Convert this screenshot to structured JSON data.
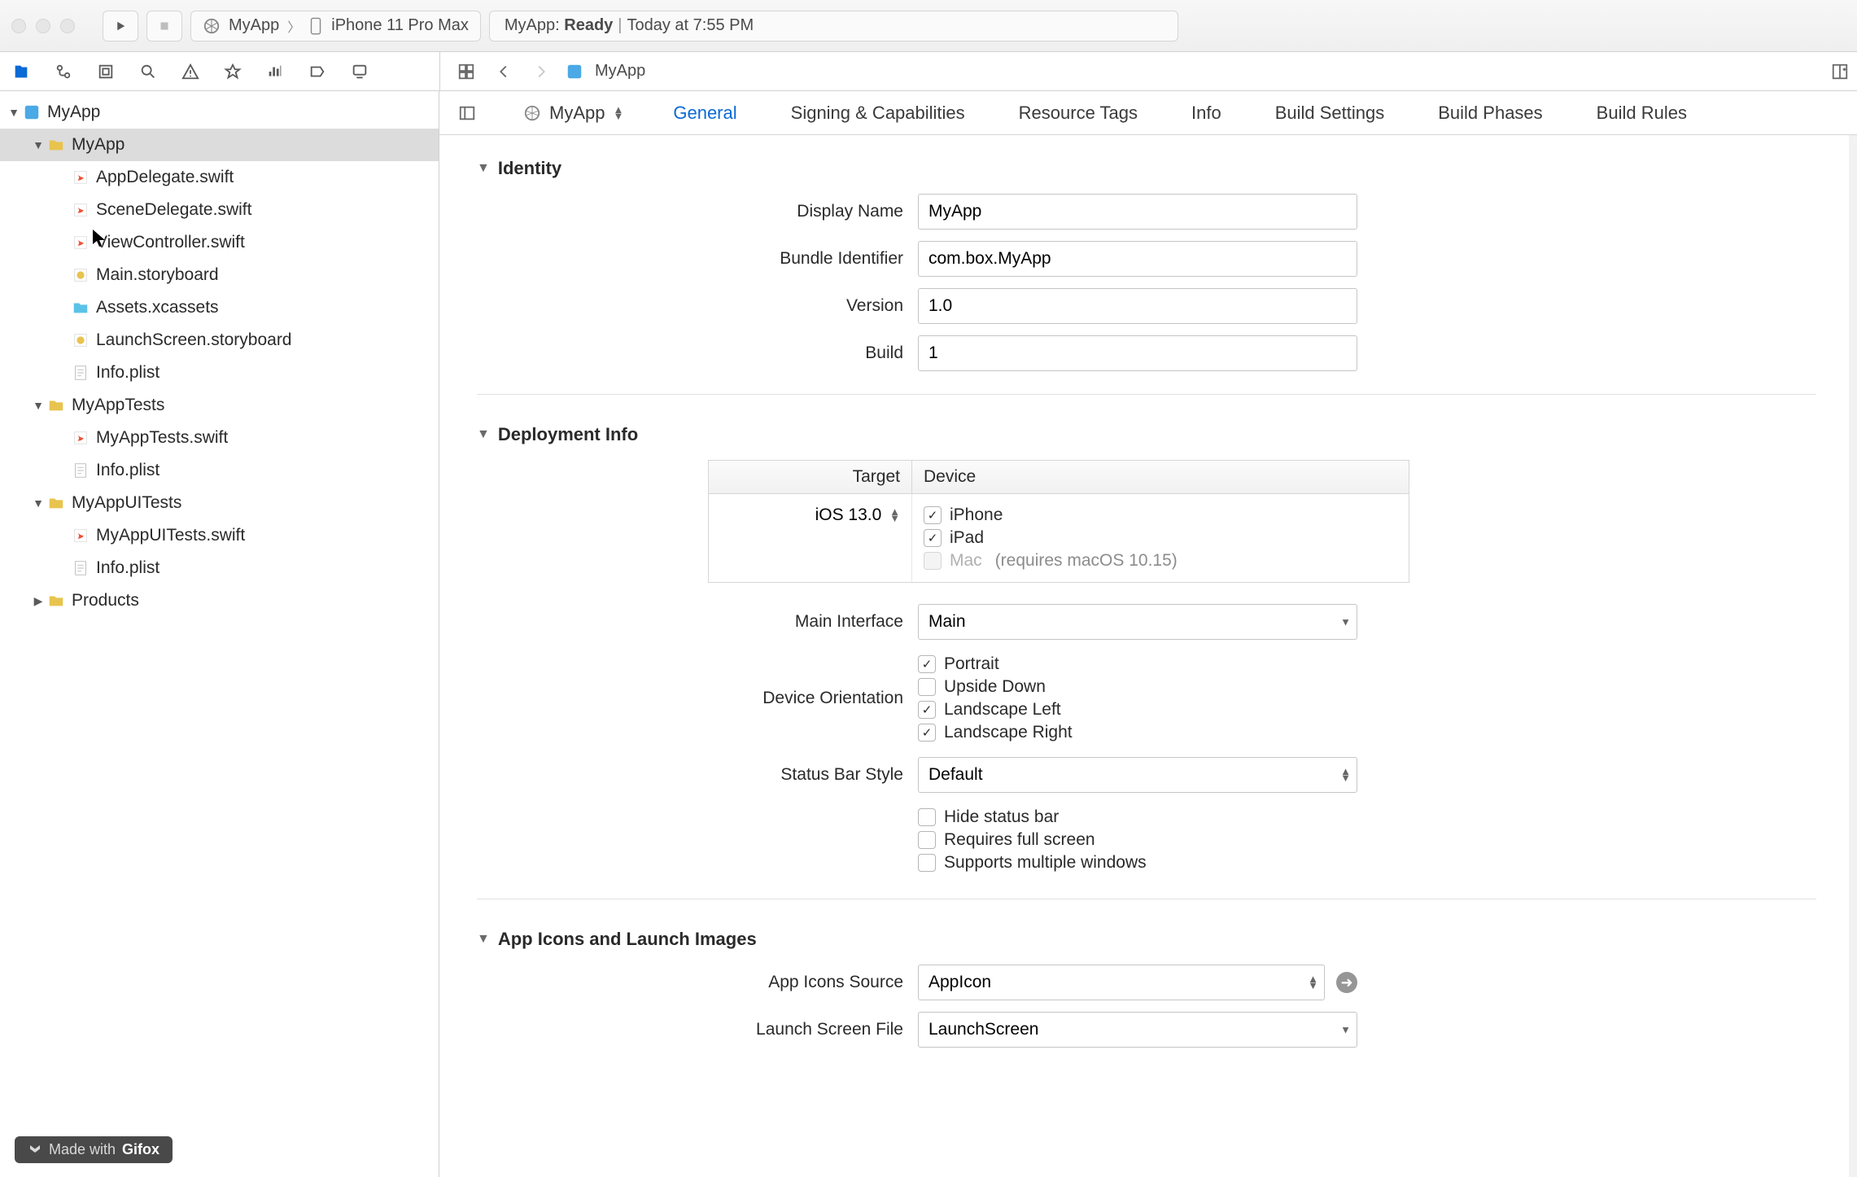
{
  "titlebar": {
    "scheme_app": "MyApp",
    "scheme_device": "iPhone 11 Pro Max",
    "status_app": "MyApp:",
    "status_state": "Ready",
    "status_time": "Today at 7:55 PM"
  },
  "jumpbar": {
    "title": "MyApp"
  },
  "tree": {
    "root": "MyApp",
    "groups": [
      {
        "name": "MyApp",
        "expanded": true,
        "selected": true,
        "children": [
          {
            "name": "AppDelegate.swift",
            "kind": "swift"
          },
          {
            "name": "SceneDelegate.swift",
            "kind": "swift"
          },
          {
            "name": "ViewController.swift",
            "kind": "swift"
          },
          {
            "name": "Main.storyboard",
            "kind": "sb"
          },
          {
            "name": "Assets.xcassets",
            "kind": "asset"
          },
          {
            "name": "LaunchScreen.storyboard",
            "kind": "sb"
          },
          {
            "name": "Info.plist",
            "kind": "plist"
          }
        ]
      },
      {
        "name": "MyAppTests",
        "expanded": true,
        "children": [
          {
            "name": "MyAppTests.swift",
            "kind": "swift"
          },
          {
            "name": "Info.plist",
            "kind": "plist"
          }
        ]
      },
      {
        "name": "MyAppUITests",
        "expanded": true,
        "children": [
          {
            "name": "MyAppUITests.swift",
            "kind": "swift"
          },
          {
            "name": "Info.plist",
            "kind": "plist"
          }
        ]
      },
      {
        "name": "Products",
        "expanded": false,
        "children": []
      }
    ]
  },
  "watermark": {
    "prefix": "Made with",
    "brand": "Gifox"
  },
  "tabs": {
    "target": "MyApp",
    "items": [
      "General",
      "Signing & Capabilities",
      "Resource Tags",
      "Info",
      "Build Settings",
      "Build Phases",
      "Build Rules"
    ],
    "active": 0
  },
  "identity": {
    "title": "Identity",
    "display_name_label": "Display Name",
    "display_name": "MyApp",
    "bundle_id_label": "Bundle Identifier",
    "bundle_id": "com.box.MyApp",
    "version_label": "Version",
    "version": "1.0",
    "build_label": "Build",
    "build": "1"
  },
  "deployment": {
    "title": "Deployment Info",
    "target_header": "Target",
    "device_header": "Device",
    "target_value": "iOS 13.0",
    "devices": [
      {
        "label": "iPhone",
        "checked": true
      },
      {
        "label": "iPad",
        "checked": true
      },
      {
        "label": "Mac",
        "checked": false,
        "disabled": true,
        "note": "(requires macOS 10.15)"
      }
    ],
    "main_interface_label": "Main Interface",
    "main_interface": "Main",
    "orientation_label": "Device Orientation",
    "orientations": [
      {
        "label": "Portrait",
        "checked": true
      },
      {
        "label": "Upside Down",
        "checked": false
      },
      {
        "label": "Landscape Left",
        "checked": true
      },
      {
        "label": "Landscape Right",
        "checked": true
      }
    ],
    "status_bar_label": "Status Bar Style",
    "status_bar": "Default",
    "extra": [
      {
        "label": "Hide status bar",
        "checked": false
      },
      {
        "label": "Requires full screen",
        "checked": false
      },
      {
        "label": "Supports multiple windows",
        "checked": false
      }
    ]
  },
  "appicons": {
    "title": "App Icons and Launch Images",
    "source_label": "App Icons Source",
    "source": "AppIcon",
    "launch_label": "Launch Screen File",
    "launch": "LaunchScreen"
  }
}
